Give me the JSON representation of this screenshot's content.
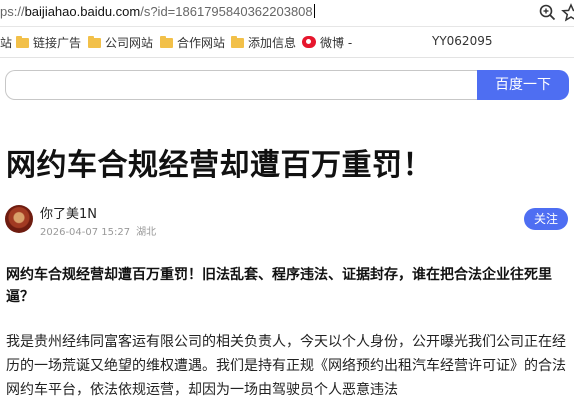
{
  "address_bar": {
    "scheme_tail": "ps://",
    "host": "baijiahao.baidu.com",
    "path": "/s?id=1861795840362203808"
  },
  "bookmarks": [
    {
      "label": "站",
      "icon": "folder-icon"
    },
    {
      "label": "链接广告",
      "icon": "folder-icon"
    },
    {
      "label": "公司网站",
      "icon": "folder-icon"
    },
    {
      "label": "合作网站",
      "icon": "folder-icon"
    },
    {
      "label": "添加信息",
      "icon": "folder-icon"
    },
    {
      "label": "微博 -",
      "icon": "weibo-icon"
    },
    {
      "label": "YY062095",
      "icon": ""
    }
  ],
  "search": {
    "button_label": "百度一下",
    "value": ""
  },
  "article": {
    "title": "网约车合规经营却遭百万重罚！",
    "author": "你了美1N",
    "date": "2026-04-07 15:27",
    "location": "湖北",
    "follow_label": "关注",
    "lead": "网约车合规经营却遭百万重罚！旧法乱套、程序违法、证据封存，谁在把合法企业往死里逼？",
    "body": "我是贵州经纬同富客运有限公司的相关负责人，今天以个人身份，公开曝光我们公司正在经历的一场荒诞又绝望的维权遭遇。我们是持有正规《网络预约出租汽车经营许可证》的合法网约车平台，依法依规运营，却因为一场由驾驶员个人恶意违法"
  },
  "colors": {
    "accent": "#4e6ef2",
    "folder": "#f2c049",
    "weibo": "#e6162d"
  }
}
